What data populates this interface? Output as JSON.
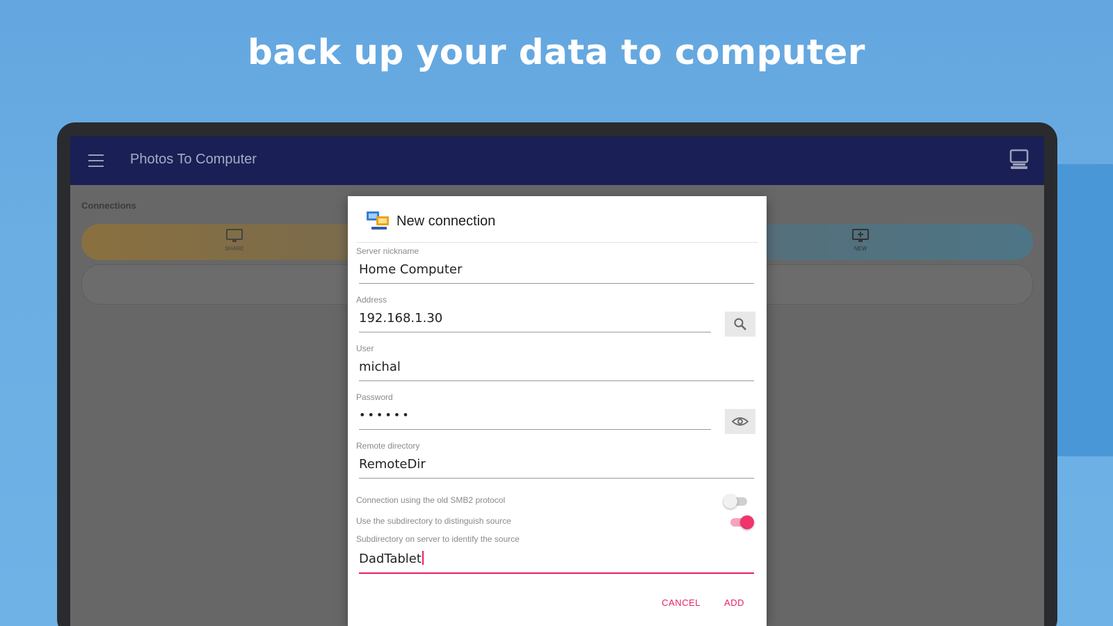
{
  "headline": "back up your data to computer",
  "app": {
    "title": "Photos To Computer",
    "menu_icon": "hamburger-menu-icon",
    "computer_icon": "computer-icon",
    "bar_color": "#1a2055"
  },
  "connections": {
    "section_label": "Connections",
    "tiles": [
      {
        "label": "SHARE",
        "icon": "monitor-icon"
      },
      {
        "label": "NEW",
        "icon": "monitor-add-icon"
      }
    ]
  },
  "dialog": {
    "title": "New connection",
    "fields": {
      "nickname": {
        "label": "Server nickname",
        "value": "Home Computer"
      },
      "address": {
        "label": "Address",
        "value": "192.168.1.30",
        "button_icon": "search-icon"
      },
      "user": {
        "label": "User",
        "value": "michal"
      },
      "password": {
        "label": "Password",
        "value": "••••••",
        "button_icon": "eye-icon"
      },
      "remote_dir": {
        "label": "Remote directory",
        "value": "RemoteDir"
      },
      "subdir": {
        "label": "Subdirectory on server to identify the source",
        "value": "DadTablet"
      }
    },
    "toggles": {
      "smb2": {
        "label": "Connection using the old SMB2 protocol",
        "on": false
      },
      "use_subdir": {
        "label": "Use the subdirectory to distinguish source",
        "on": true
      }
    },
    "actions": {
      "cancel": "CANCEL",
      "add": "ADD"
    },
    "accent_color": "#e91e63"
  }
}
